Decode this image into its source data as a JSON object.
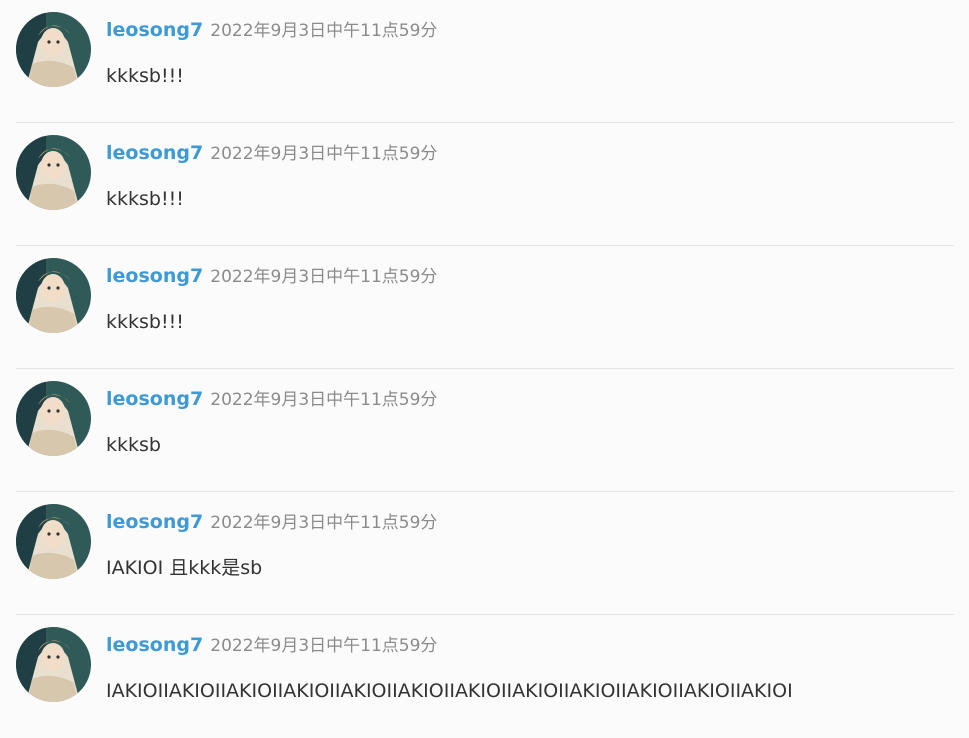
{
  "avatar_icon": "user-avatar",
  "accent_color": "#3e9ad4",
  "comments": [
    {
      "author": "leosong7",
      "time": "2022年9月3日中午11点59分",
      "text": "kkksb!!!"
    },
    {
      "author": "leosong7",
      "time": "2022年9月3日中午11点59分",
      "text": "kkksb!!!"
    },
    {
      "author": "leosong7",
      "time": "2022年9月3日中午11点59分",
      "text": "kkksb!!!"
    },
    {
      "author": "leosong7",
      "time": "2022年9月3日中午11点59分",
      "text": "kkksb"
    },
    {
      "author": "leosong7",
      "time": "2022年9月3日中午11点59分",
      "text": "IAKIOI 且kkk是sb"
    },
    {
      "author": "leosong7",
      "time": "2022年9月3日中午11点59分",
      "text": "IAKIOIIAKIOIIAKIOIIAKIOIIAKIOIIAKIOIIAKIOIIAKIOIIAKIOIIAKIOIIAKIOIIAKIOI"
    }
  ]
}
